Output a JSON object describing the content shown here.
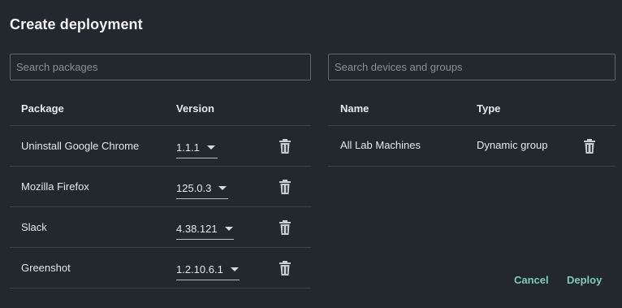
{
  "dialog": {
    "title": "Create deployment"
  },
  "packages": {
    "search_placeholder": "Search packages",
    "columns": {
      "package": "Package",
      "version": "Version"
    },
    "rows": [
      {
        "name": "Uninstall Google Chrome",
        "version": "1.1.1"
      },
      {
        "name": "Mozilla Firefox",
        "version": "125.0.3"
      },
      {
        "name": "Slack",
        "version": "4.38.121"
      },
      {
        "name": "Greenshot",
        "version": "1.2.10.6.1"
      }
    ]
  },
  "devices": {
    "search_placeholder": "Search devices and groups",
    "columns": {
      "name": "Name",
      "type": "Type"
    },
    "rows": [
      {
        "name": "All Lab Machines",
        "type": "Dynamic group"
      }
    ]
  },
  "actions": {
    "cancel": "Cancel",
    "deploy": "Deploy"
  },
  "colors": {
    "background": "#23272e",
    "accent": "#7ecbb6",
    "divider": "#3d434b"
  },
  "icons": {
    "delete": "trash-icon",
    "select": "chevron-down-icon"
  }
}
